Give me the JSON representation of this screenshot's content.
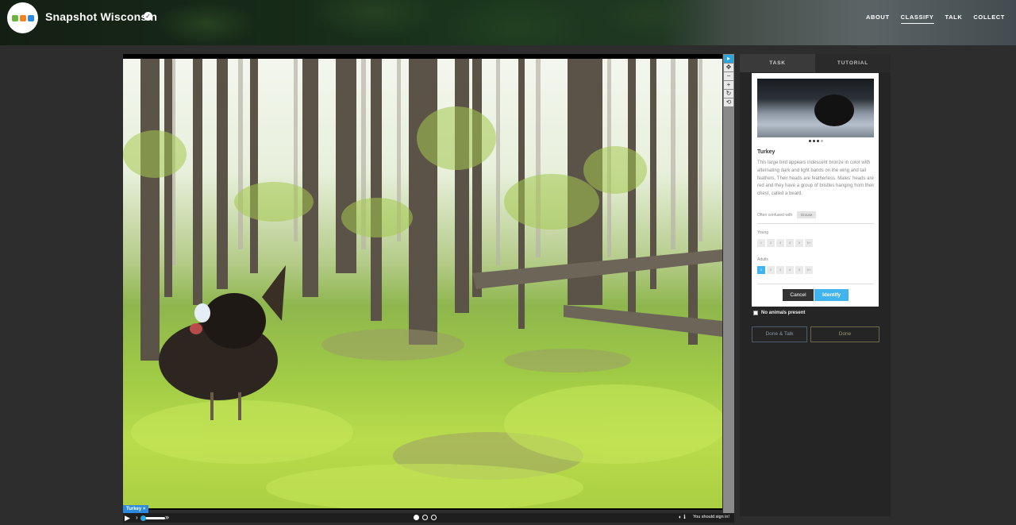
{
  "header": {
    "brand": "Snapshot Wisconsin",
    "nav": [
      {
        "label": "ABOUT"
      },
      {
        "label": "CLASSIFY",
        "active": true
      },
      {
        "label": "TALK"
      },
      {
        "label": "COLLECT"
      }
    ]
  },
  "viewer": {
    "subject_badge": "Turkey",
    "frames": 3,
    "active_frame": 1,
    "signin_notice": "You should sign in!"
  },
  "tools": {
    "icons": [
      "pointer-icon",
      "move-icon",
      "zoom-out-icon",
      "zoom-in-icon",
      "rotate-icon",
      "reset-icon"
    ]
  },
  "panel": {
    "tabs": [
      {
        "label": "TASK",
        "active": true
      },
      {
        "label": "TUTORIAL",
        "active": false
      }
    ],
    "species": {
      "name": "Turkey",
      "description": "This large bird appears iridescent bronze in color with alternating dark and light bands on the wing and tail feathers. Their heads are featherless. Males' heads are red and they have a group of bristles hanging from their chest, called a beard.",
      "confused_label": "Often confused with",
      "confused_with": "Grouse",
      "young_label": "Young",
      "adults_label": "Adults",
      "count_options": [
        "1",
        "2",
        "3",
        "4",
        "5",
        "6+"
      ],
      "selected_adults": "1",
      "cancel_label": "Cancel",
      "identify_label": "Identify"
    },
    "no_animals_label": "No animals present",
    "done_talk_label": "Done & Talk",
    "done_label": "Done"
  },
  "colors": {
    "accent": "#41b4ee",
    "badge": "#2b8ae0"
  }
}
